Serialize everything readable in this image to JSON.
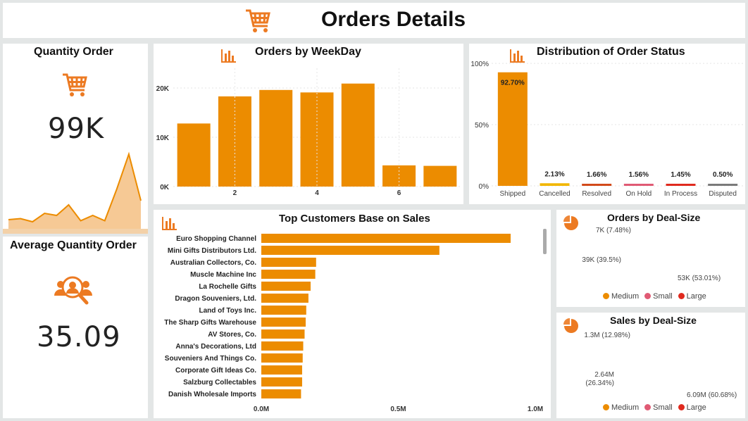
{
  "header": {
    "title": "Orders Details",
    "icon": "cart-icon"
  },
  "quantity_card": {
    "title": "Quantity Order",
    "value": "99K",
    "icon": "cart-icon",
    "sparkline": [
      10,
      11,
      8,
      16,
      14,
      24,
      9,
      14,
      9,
      39,
      72,
      28
    ]
  },
  "average_card": {
    "title": "Average Quantity Order",
    "value": "35.09",
    "icon": "users-search-icon"
  },
  "colors": {
    "bar": "#ec8c00",
    "medium": "#ec8c00",
    "small": "#e05a74",
    "large": "#e02a1e",
    "area": "#f6c995",
    "shipped": "#ec8c00",
    "cancelled": "#f2b700",
    "resolved": "#d24a1a",
    "onhold": "#e05a74",
    "inprocess": "#e02a1e",
    "disputed": "#7a7a7a"
  },
  "chart_data": [
    {
      "id": "weekday",
      "type": "bar",
      "title": "Orders by WeekDay",
      "x": [
        1,
        2,
        3,
        4,
        5,
        6,
        7
      ],
      "values": [
        12800,
        18300,
        19600,
        19100,
        20900,
        4300,
        4200
      ],
      "xticks": [
        "2",
        "4",
        "6"
      ],
      "yticks": [
        "0K",
        "10K",
        "20K"
      ],
      "ylim": [
        0,
        24000
      ]
    },
    {
      "id": "status",
      "type": "bar",
      "title": "Distribution of Order Status",
      "categories": [
        "Shipped",
        "Cancelled",
        "Resolved",
        "On Hold",
        "In Process",
        "Disputed"
      ],
      "values": [
        92.7,
        2.13,
        1.66,
        1.56,
        1.45,
        0.5
      ],
      "labels": [
        "92.70%",
        "2.13%",
        "1.66%",
        "1.56%",
        "1.45%",
        "0.50%"
      ],
      "yticks": [
        "0%",
        "50%",
        "100%"
      ],
      "ylim": [
        0,
        100
      ]
    },
    {
      "id": "customers",
      "type": "bar",
      "orientation": "horizontal",
      "title": "Top Customers Base on Sales",
      "categories": [
        "Euro Shopping Channel",
        "Mini Gifts Distributors Ltd.",
        "Australian Collectors, Co.",
        "Muscle Machine Inc",
        "La Rochelle Gifts",
        "Dragon Souveniers, Ltd.",
        "Land of Toys Inc.",
        "The Sharp Gifts Warehouse",
        "AV Stores, Co.",
        "Anna's Decorations, Ltd",
        "Souveniers And Things Co.",
        "Corporate Gift Ideas Co.",
        "Salzburg Collectables",
        "Danish Wholesale Imports"
      ],
      "values": [
        0.91,
        0.65,
        0.2,
        0.197,
        0.18,
        0.172,
        0.164,
        0.162,
        0.158,
        0.153,
        0.151,
        0.149,
        0.149,
        0.145
      ],
      "xticks": [
        "0.0M",
        "0.5M",
        "1.0M"
      ],
      "xlim": [
        0,
        1.0
      ]
    },
    {
      "id": "orders_deal",
      "type": "pie",
      "title": "Orders by Deal-Size",
      "categories": [
        "Medium",
        "Small",
        "Large"
      ],
      "values": [
        53.01,
        39.5,
        7.48
      ],
      "labels": [
        "53K (53.01%)",
        "39K (39.5%)",
        "7K (7.48%)"
      ]
    },
    {
      "id": "sales_deal",
      "type": "pie",
      "title": "Sales by Deal-Size",
      "categories": [
        "Medium",
        "Small",
        "Large"
      ],
      "values": [
        60.68,
        26.34,
        12.98
      ],
      "labels": [
        "6.09M (60.68%)",
        "2.64M\n(26.34%)",
        "1.3M (12.98%)"
      ]
    }
  ]
}
